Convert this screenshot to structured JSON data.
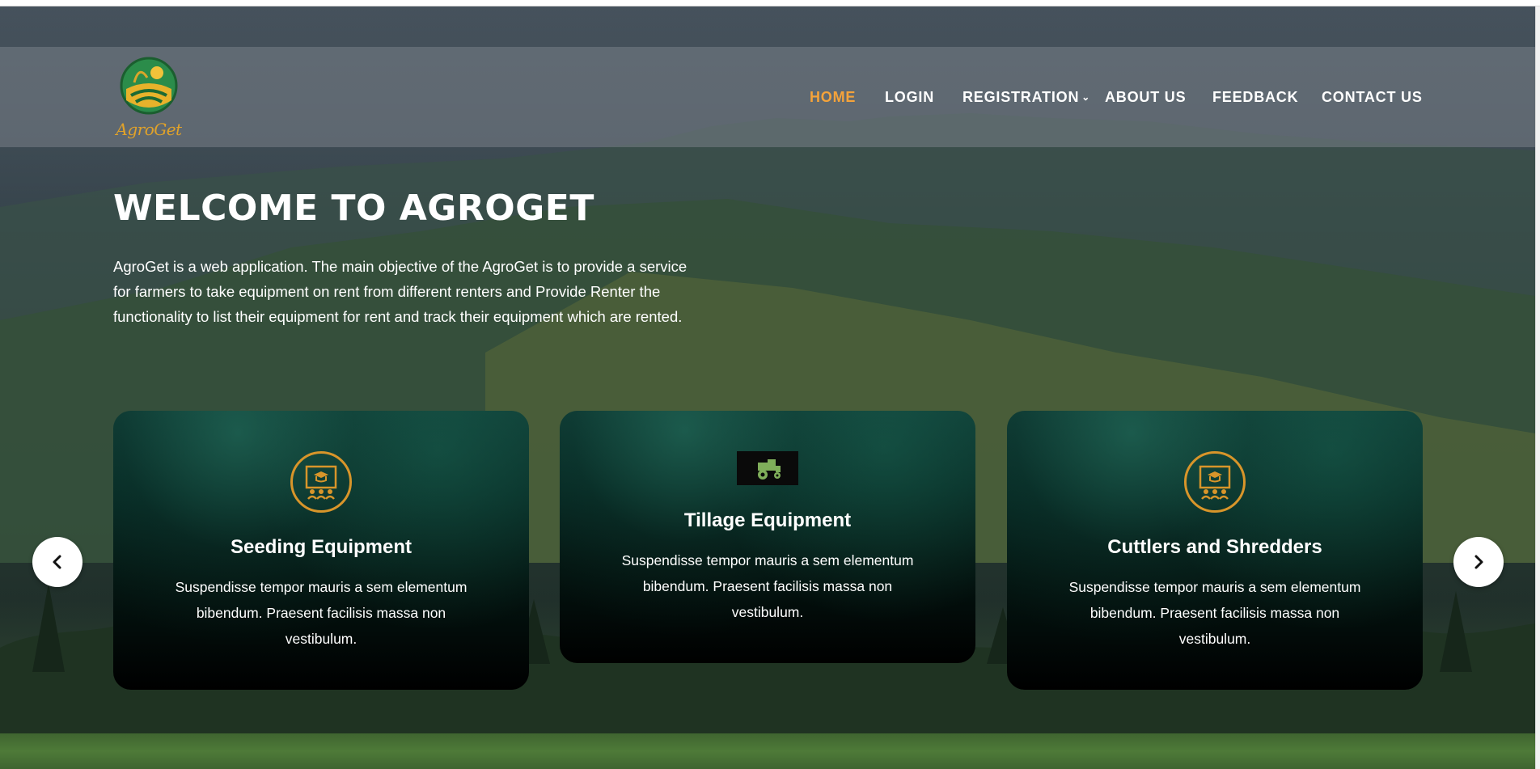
{
  "brand": {
    "name": "AgroGet",
    "logo_text": "AgroGet",
    "accent_color": "#f5a33a",
    "icon_gold": "#d8952a"
  },
  "nav": {
    "items": [
      {
        "label": "HOME",
        "active": true
      },
      {
        "label": "LOGIN",
        "active": false
      },
      {
        "label": "REGISTRATION",
        "active": false,
        "has_dropdown": true
      },
      {
        "label": "ABOUT US",
        "active": false
      },
      {
        "label": "FEEDBACK",
        "active": false
      },
      {
        "label": "CONTACT US",
        "active": false
      }
    ],
    "dropdown_icon": "chevron-down-icon"
  },
  "hero": {
    "title": "WELCOME TO AGROGET",
    "intro": "AgroGet is a web application. The main objective of the AgroGet is to provide a service for farmers to take equipment on rent from different renters and Provide Renter the functionality to list their equipment for rent and track their equipment which are rented."
  },
  "cards": [
    {
      "title": "Seeding Equipment",
      "text": "Suspendisse tempor mauris a sem elementum bibendum. Praesent facilisis massa non vestibulum.",
      "icon": "training-board-icon"
    },
    {
      "title": "Tillage Equipment",
      "text": "Suspendisse tempor mauris a sem elementum bibendum. Praesent facilisis massa non vestibulum.",
      "icon": "tractor-icon"
    },
    {
      "title": "Cuttlers and Shredders",
      "text": "Suspendisse tempor mauris a sem elementum bibendum. Praesent facilisis massa non vestibulum.",
      "icon": "training-board-icon"
    }
  ],
  "carousel": {
    "prev_icon": "chevron-left-icon",
    "next_icon": "chevron-right-icon"
  }
}
